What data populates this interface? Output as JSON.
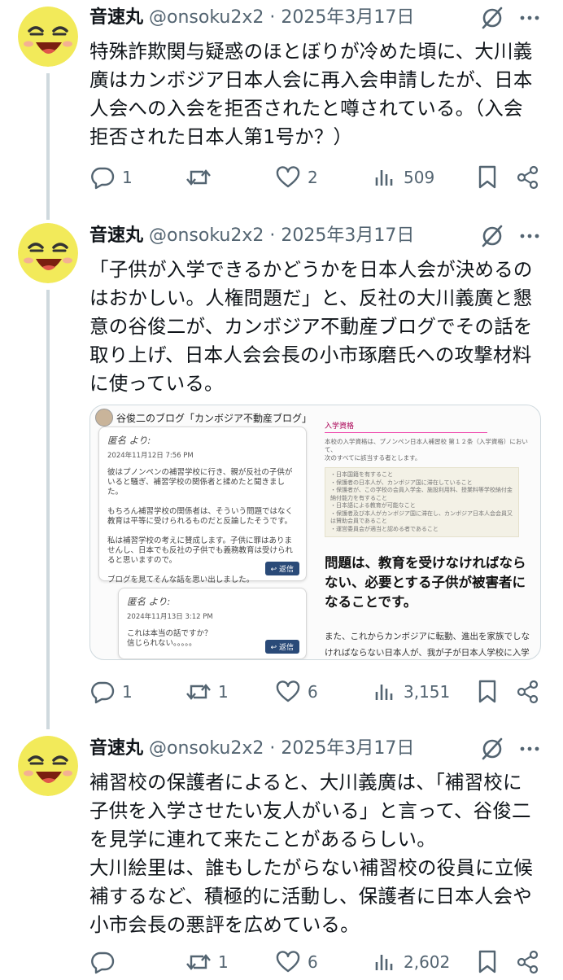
{
  "tweets": [
    {
      "author": "音速丸",
      "handle": "@onsoku2x2",
      "sep": " · ",
      "date": "2025年3月17日",
      "text": "特殊詐欺関与疑惑のほとぼりが冷めた頃に、大川義廣はカンボジア日本人会に再入会申請したが、日本人会への入会を拒否されたと噂されている。（入会拒否された日本人第1号か？）",
      "replies": "1",
      "retweets": "",
      "likes": "2",
      "views": "509"
    },
    {
      "author": "音速丸",
      "handle": "@onsoku2x2",
      "sep": " · ",
      "date": "2025年3月17日",
      "text": "「子供が入学できるかどうかを日本人会が決めるのはおかしい。人権問題だ」と、反社の大川義廣と懇意の谷俊二が、カンボジア不動産ブログでその話を取り上げ、日本人会会長の小市琢磨氏への攻撃材料に使っている。",
      "replies": "1",
      "retweets": "1",
      "likes": "6",
      "views": "3,151"
    },
    {
      "author": "音速丸",
      "handle": "@onsoku2x2",
      "sep": " · ",
      "date": "2025年3月17日",
      "text": "補習校の保護者によると、大川義廣は、「補習校に子供を入学させたい友人がいる」と言って、谷俊二を見学に連れて来たことがあるらしい。\n大川絵里は、誰もしたがらない補習校の役員に立候補するなど、積極的に活動し、保護者に日本人会や小市会長の悪評を広めている。",
      "replies": "",
      "retweets": "1",
      "likes": "6",
      "views": "2,602"
    }
  ],
  "embed": {
    "blog_title": "谷俊二のブログ「カンボジア不動産ブログ」",
    "comment1": {
      "name": "匿名 より:",
      "date": "2024年11月12日 7:56 PM",
      "body": "彼はプノンペンの補習学校に行き、親が反社の子供がいると騒ぎ、補習学校の関係者と揉めたと聞きました。\n\nもちろん補習学校の関係者は、そういう問題ではなく教育は平等に受けられるものだと反論したそうです。\n\n私は補習学校の考えに賛成します。子供に罪はありませんし、日本でも反社の子供でも義務教育は受けられると思いますので。\n\nブログを見てそんな話を思い出しました。",
      "reply": "↩ 返信"
    },
    "comment2": {
      "name": "匿名 より:",
      "date": "2024年11月13日 3:12 PM",
      "body": "これは本当の話ですか？\n信じられない。。。。。",
      "reply": "↩ 返信"
    },
    "section_head": "入学資格",
    "section_small": "本校の入学資格は、プノンペン日本人補習校 第１２条（入学資格）において、\n次のすべてに該当する者とします。",
    "section_list": "・日本国籍を有すること\n・保護者の日本人が、カンボジア国に滞在していること\n・保護者が、この学校の会員入学金、施設利用料、授業料等学校納付金納付能力を有すること\n・日本語による教育が可能なこと\n・保護者及び本人がカンボジア国に滞在し、カンボジア日本人会会員又は賛助会員であること\n・運営委員会が適当と認める者であること",
    "bold_text": "問題は、教育を受けなければならない、必要とする子供が被害者になることです。",
    "para": "また、これからカンボジアに転勤、進出を家族でしなければならない日本人が、我が子が日本人学校に入学できるかどうかが、小市琢磨の恣意的判断で決"
  },
  "icons": {
    "grok": "grok-icon",
    "more": "more-icon",
    "reply": "reply-icon",
    "retweet": "retweet-icon",
    "like": "like-icon",
    "views": "views-icon",
    "bookmark": "bookmark-icon",
    "share": "share-icon"
  },
  "colors": {
    "text": "#0f1419",
    "secondary": "#536471",
    "thread": "#cfd9de",
    "avatar": "#f2ea5a"
  }
}
